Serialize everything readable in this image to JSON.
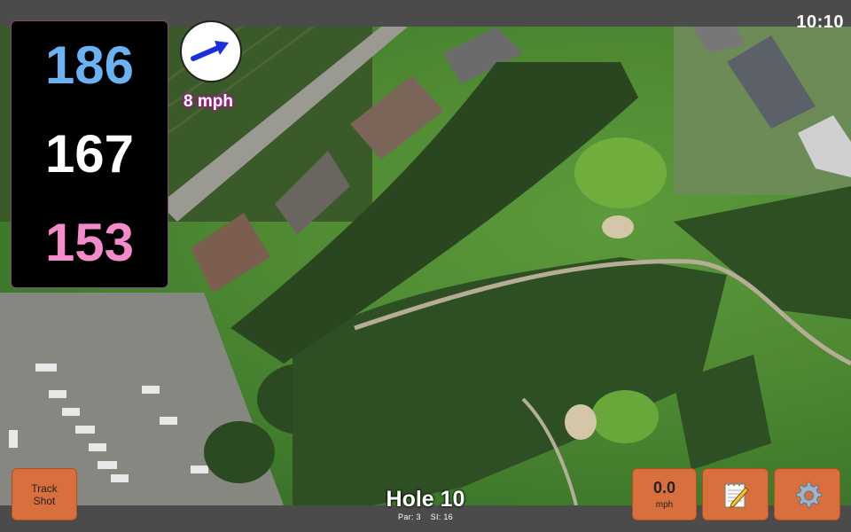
{
  "status": {
    "time": "10:10"
  },
  "distances": {
    "back": "186",
    "middle": "167",
    "front": "153"
  },
  "wind": {
    "speed_label": "8 mph",
    "direction": "north-east"
  },
  "hole": {
    "title": "Hole 10",
    "par": "Par: 3",
    "stroke_index": "SI: 16"
  },
  "controls": {
    "track_shot_line1": "Track",
    "track_shot_line2": "Shot",
    "wind_value": "0.0",
    "wind_unit": "mph",
    "notes_icon": "notepad-icon",
    "settings_icon": "gear-icon"
  },
  "colors": {
    "back_distance": "#6ab2f2",
    "middle_distance": "#ffffff",
    "front_distance": "#f58bcb",
    "button": "#d86f3d",
    "wind_arrow": "#1a2fe0"
  }
}
